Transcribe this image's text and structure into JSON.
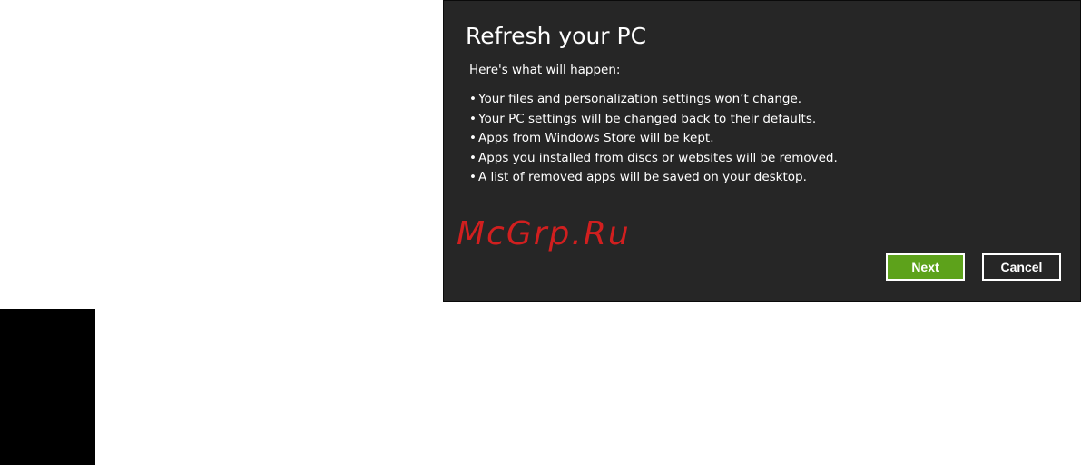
{
  "dialog": {
    "title": "Refresh your PC",
    "intro": "Here's what will happen:",
    "bullets": [
      "Your files and personalization settings won’t change.",
      "Your PC settings will be changed back to their defaults.",
      "Apps from Windows Store will be kept.",
      "Apps you installed from discs or websites will be removed.",
      "A list of removed apps will be saved on your desktop."
    ],
    "bullet_glyph": "•",
    "next_label": "Next",
    "cancel_label": "Cancel"
  },
  "watermark": "McGrp.Ru",
  "colors": {
    "dialog_bg": "#262626",
    "next_button": "#5da21b",
    "watermark": "#d11f1f",
    "text": "#ffffff"
  }
}
